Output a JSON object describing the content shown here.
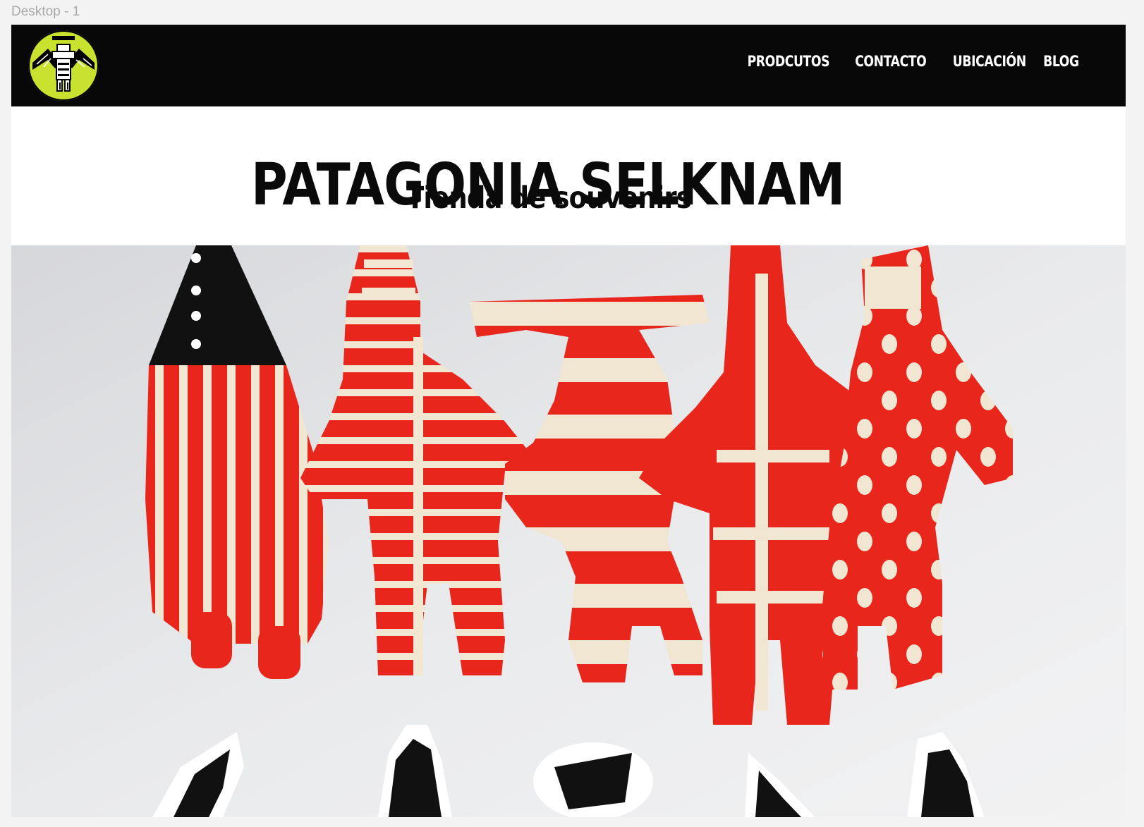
{
  "frame": {
    "label": "Desktop - 1"
  },
  "header": {
    "logo_icon": "selknam-figure-logo-icon",
    "nav": [
      {
        "label": "PRODCUTOS"
      },
      {
        "label": "CONTACTO"
      },
      {
        "label": "UBICACIÓN"
      },
      {
        "label": "BLOG"
      }
    ]
  },
  "hero": {
    "title": "PATAGONIA SELKNAM",
    "subtitle": "Tienda de souvenirs",
    "image": "photo of five red-and-white Selknam cloth dolls with black stickers"
  },
  "colors": {
    "nav_bg": "#080808",
    "logo_accent": "#c9e230",
    "doll_red": "#e8261c",
    "doll_cream": "#f1e6d2"
  }
}
